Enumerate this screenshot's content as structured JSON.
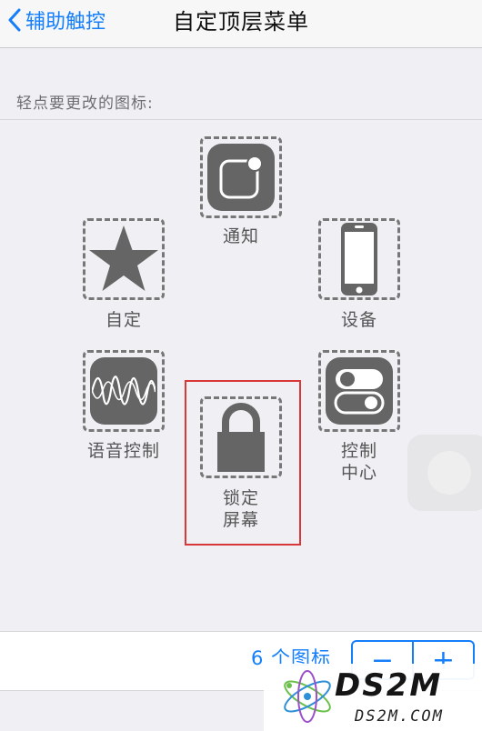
{
  "navbar": {
    "back_label": "辅助触控",
    "title": "自定顶层菜单"
  },
  "section_header": "轻点要更改的图标:",
  "icons": {
    "notification": {
      "label": "通知",
      "icon": "notification-icon"
    },
    "custom": {
      "label": "自定",
      "icon": "star-icon"
    },
    "device": {
      "label": "设备",
      "icon": "iphone-icon"
    },
    "voice": {
      "label": "语音控制",
      "icon": "waveform-icon"
    },
    "lock": {
      "label_line1": "锁定",
      "label_line2": "屏幕",
      "icon": "lock-icon"
    },
    "control": {
      "label_line1": "控制",
      "label_line2": "中心",
      "icon": "toggle-switches-icon"
    }
  },
  "bottom": {
    "count_text": "6 个图标",
    "minus": "−",
    "plus": "+"
  },
  "watermark": {
    "main": "DS2M",
    "sub": "DS2M.COM"
  },
  "colors": {
    "accent": "#147efb",
    "tile": "#656565",
    "highlight": "#d9383a"
  }
}
